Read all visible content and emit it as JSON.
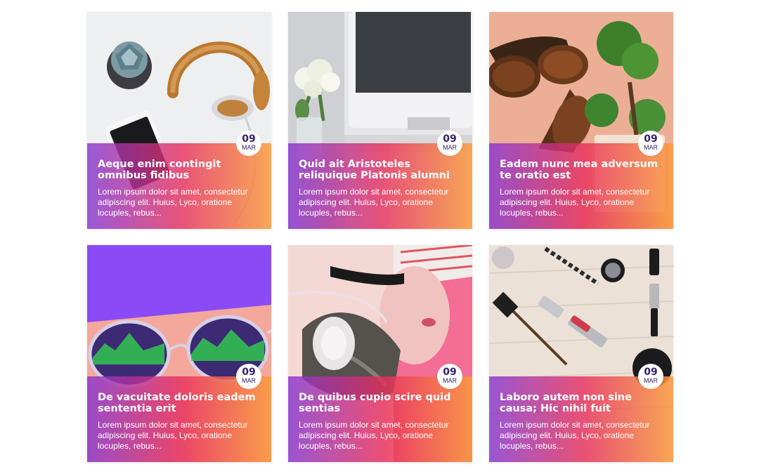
{
  "posts": [
    {
      "title": "Aeque enim contingit omnibus fidibus",
      "excerpt": "Lorem ipsum dolor sit amet, consectetur adipiscing elit. Huius, Lyco, oratione locuples, rebus...",
      "day": "09",
      "month": "MAR",
      "photo": "headphones-phone-succulent-desk"
    },
    {
      "title": "Quid ait Aristoteles reliquique Platonis alumni",
      "excerpt": "Lorem ipsum dolor sit amet, consectetur adipiscing elit. Huius, Lyco, oratione locuples, rebus...",
      "day": "09",
      "month": "MAR",
      "photo": "monitor-flowers-workspace"
    },
    {
      "title": "Eadem nunc mea adversum te oratio est",
      "excerpt": "Lorem ipsum dolor sit amet, consectetur adipiscing elit. Huius, Lyco, oratione locuples, rebus...",
      "day": "09",
      "month": "MAR",
      "photo": "sunglasses-bonsai"
    },
    {
      "title": "De vacuitate doloris eadem sententia erit",
      "excerpt": "Lorem ipsum dolor sit amet, consectetur adipiscing elit. Huius, Lyco, oratione locuples, rebus...",
      "day": "09",
      "month": "MAR",
      "photo": "retro-glasses-neon"
    },
    {
      "title": "De quibus cupio scire quid sentias",
      "excerpt": "Lorem ipsum dolor sit amet, consectetur adipiscing elit. Huius, Lyco, oratione locuples, rebus...",
      "day": "09",
      "month": "MAR",
      "photo": "woman-headphones-pink"
    },
    {
      "title": "Laboro autem non sine causa; Hic nihil fuit",
      "excerpt": "Lorem ipsum dolor sit amet, consectetur adipiscing elit. Huius, Lyco, oratione locuples, rebus...",
      "day": "09",
      "month": "MAR",
      "photo": "makeup-flatlay"
    }
  ],
  "colors": {
    "date_text": "#35206e",
    "gradient": [
      "#8737d2",
      "#e82d5a",
      "#fa9b3c"
    ]
  }
}
